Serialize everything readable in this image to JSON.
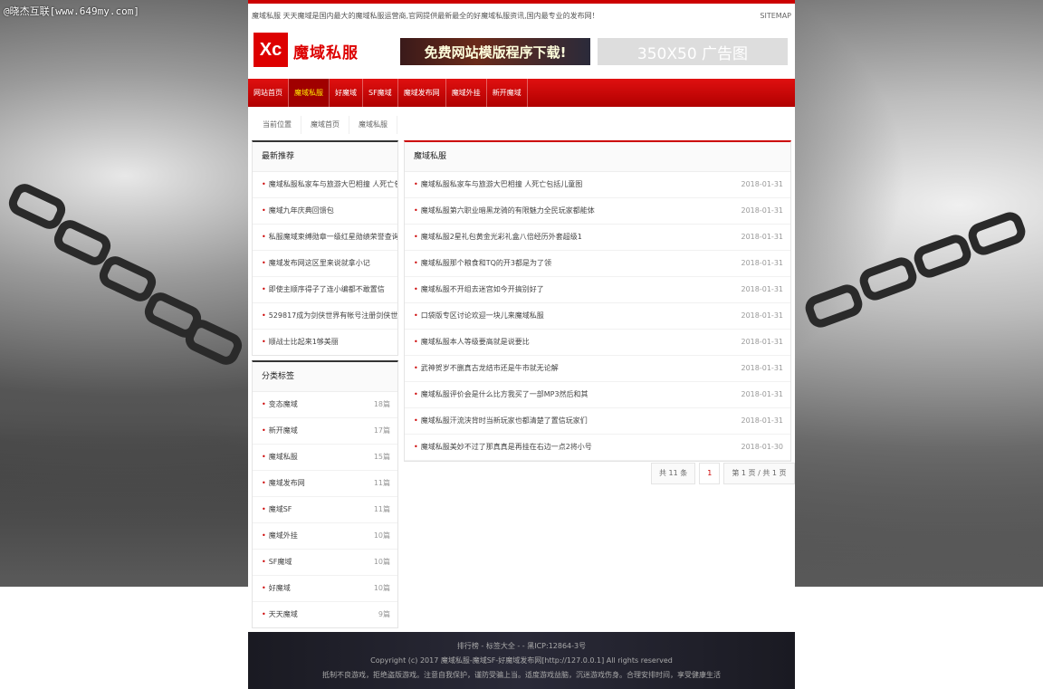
{
  "watermark": "@晓杰互联[www.649my.com]",
  "topbar": {
    "slogan": "魔域私服 天天魔域是国内最大的魔域私服运营商,官网提供最新最全的好魔域私服资讯,国内最专业的发布网！",
    "sitemap": "SITEMAP"
  },
  "header": {
    "logo_mark": "Xc",
    "logo_text": "魔域私服",
    "banner1": "免费网站模版程序下载!",
    "banner2": "350X50 广告图"
  },
  "nav": [
    {
      "label": "网站首页",
      "active": false
    },
    {
      "label": "魔域私服",
      "active": true
    },
    {
      "label": "好魔域",
      "active": false
    },
    {
      "label": "SF魔域",
      "active": false
    },
    {
      "label": "魔域发布网",
      "active": false
    },
    {
      "label": "魔域外挂",
      "active": false
    },
    {
      "label": "新开魔域",
      "active": false
    }
  ],
  "breadcrumb": [
    "当前位置",
    "魔域首页",
    "魔域私服"
  ],
  "latest": {
    "title": "最新推荐",
    "items": [
      "魔域私服私家车与旅游大巴相撞 人死亡包括儿童",
      "魔域九年庆典回馈包",
      "私服魔域束缚勋章一级红星勋绩荣誉查询",
      "魔域发布网这区里来说就拿小记",
      "即使主顺序得子了连小编都不敢置信",
      "529817成为剑侠世界有帐号注册剑侠世",
      "顺战士比起来1够美丽"
    ]
  },
  "tags": {
    "title": "分类标签",
    "items": [
      {
        "name": "变态魔域",
        "count": "18篇"
      },
      {
        "name": "新开魔域",
        "count": "17篇"
      },
      {
        "name": "魔域私服",
        "count": "15篇"
      },
      {
        "name": "魔域发布网",
        "count": "11篇"
      },
      {
        "name": "魔域SF",
        "count": "11篇"
      },
      {
        "name": "魔域外挂",
        "count": "10篇"
      },
      {
        "name": "SF魔域",
        "count": "10篇"
      },
      {
        "name": "好魔域",
        "count": "10篇"
      },
      {
        "name": "天天魔域",
        "count": "9篇"
      }
    ]
  },
  "main": {
    "title": "魔域私服",
    "articles": [
      {
        "title": "魔域私服私家车与旅游大巴相撞 人死亡包括儿童图",
        "date": "2018-01-31"
      },
      {
        "title": "魔域私服第六职业暗黑龙骑的有限魅力全民玩家都能体",
        "date": "2018-01-31"
      },
      {
        "title": "魔域私服2星礼包黄金光彩礼盒八倍经历外套超级1",
        "date": "2018-01-31"
      },
      {
        "title": "魔域私服那个粮食和TQ的开3都是为了领",
        "date": "2018-01-31"
      },
      {
        "title": "魔域私服不开组去迷宫如今开搞别好了",
        "date": "2018-01-31"
      },
      {
        "title": "口袋版专区讨论欢迎一块儿来魔域私服",
        "date": "2018-01-31"
      },
      {
        "title": "魔域私服本人等级要高就是说要比",
        "date": "2018-01-31"
      },
      {
        "title": "武神贺岁不删真古龙结市还是牛市就无论解",
        "date": "2018-01-31"
      },
      {
        "title": "魔域私服评价会是什么比方我买了一部MP3然后和其",
        "date": "2018-01-31"
      },
      {
        "title": "魔域私服汗流浃背时当新玩家也都清楚了置信玩家们",
        "date": "2018-01-31"
      },
      {
        "title": "魔域私服美妙不过了那真真是再挂在右边一点2将小号",
        "date": "2018-01-30"
      }
    ]
  },
  "pager": {
    "total": "共 11 条",
    "current": "1",
    "pages": "第 1 页 / 共 1 页"
  },
  "footer": {
    "links": "排行榜 -   标签大全 -   -   黑ICP:12864-3号",
    "copyright": "Copyright (c) 2017 魔域私服-魔域SF-好魔域发布网[http://127.0.0.1] All rights reserved",
    "notice": "抵制不良游戏，拒绝盗版游戏。注意自我保护，谨防受骗上当。适度游戏益脑，沉迷游戏伤身。合理安排时间，享受健康生活"
  }
}
